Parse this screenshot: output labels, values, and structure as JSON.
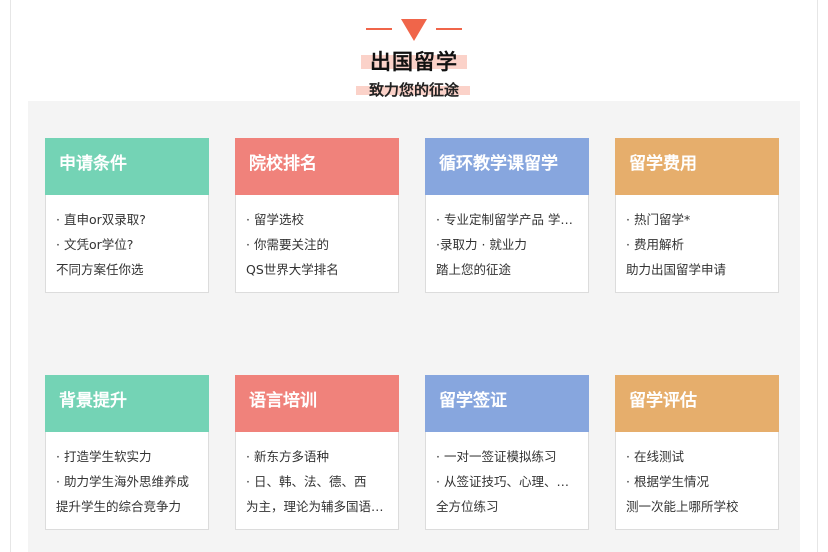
{
  "section": {
    "title": "出国留学",
    "subtitle": "致力您的征途"
  },
  "colors": {
    "accent": "#f0654a",
    "highlight": "#fbd2c9",
    "green": "#74d3b5",
    "red": "#f0827b",
    "blue": "#87a6de",
    "orange": "#e6ae6c",
    "panel": "#f4f4f4"
  },
  "cards": [
    {
      "title": "申请条件",
      "color": "#74d3b5",
      "lines": [
        "· 直申or双录取?",
        "· 文凭or学位?",
        "不同方案任你选"
      ]
    },
    {
      "title": "院校排名",
      "color": "#f0827b",
      "lines": [
        "· 留学选校",
        "· 你需要关注的",
        "QS世界大学排名"
      ]
    },
    {
      "title": "循环教学课留学",
      "color": "#87a6de",
      "lines": [
        "· 专业定制留学产品 学费无忧",
        "·录取力 · 就业力",
        "踏上您的征途"
      ]
    },
    {
      "title": "留学费用",
      "color": "#e6ae6c",
      "lines": [
        "· 热门留学*",
        "· 费用解析",
        "助力出国留学申请"
      ]
    },
    {
      "title": "背景提升",
      "color": "#74d3b5",
      "lines": [
        "· 打造学生软实力",
        "· 助力学生海外思维养成",
        "提升学生的综合竞争力"
      ]
    },
    {
      "title": "语言培训",
      "color": "#f0827b",
      "lines": [
        "· 新东方多语种",
        "· 日、韩、法、德、西",
        "为主，理论为辅多国语言培训"
      ]
    },
    {
      "title": "留学签证",
      "color": "#87a6de",
      "lines": [
        "· 一对一签证模拟练习",
        "· 从签证技巧、心理、着装",
        "全方位练习"
      ]
    },
    {
      "title": "留学评估",
      "color": "#e6ae6c",
      "lines": [
        "· 在线测试",
        "· 根据学生情况",
        "测一次能上哪所学校"
      ]
    }
  ]
}
